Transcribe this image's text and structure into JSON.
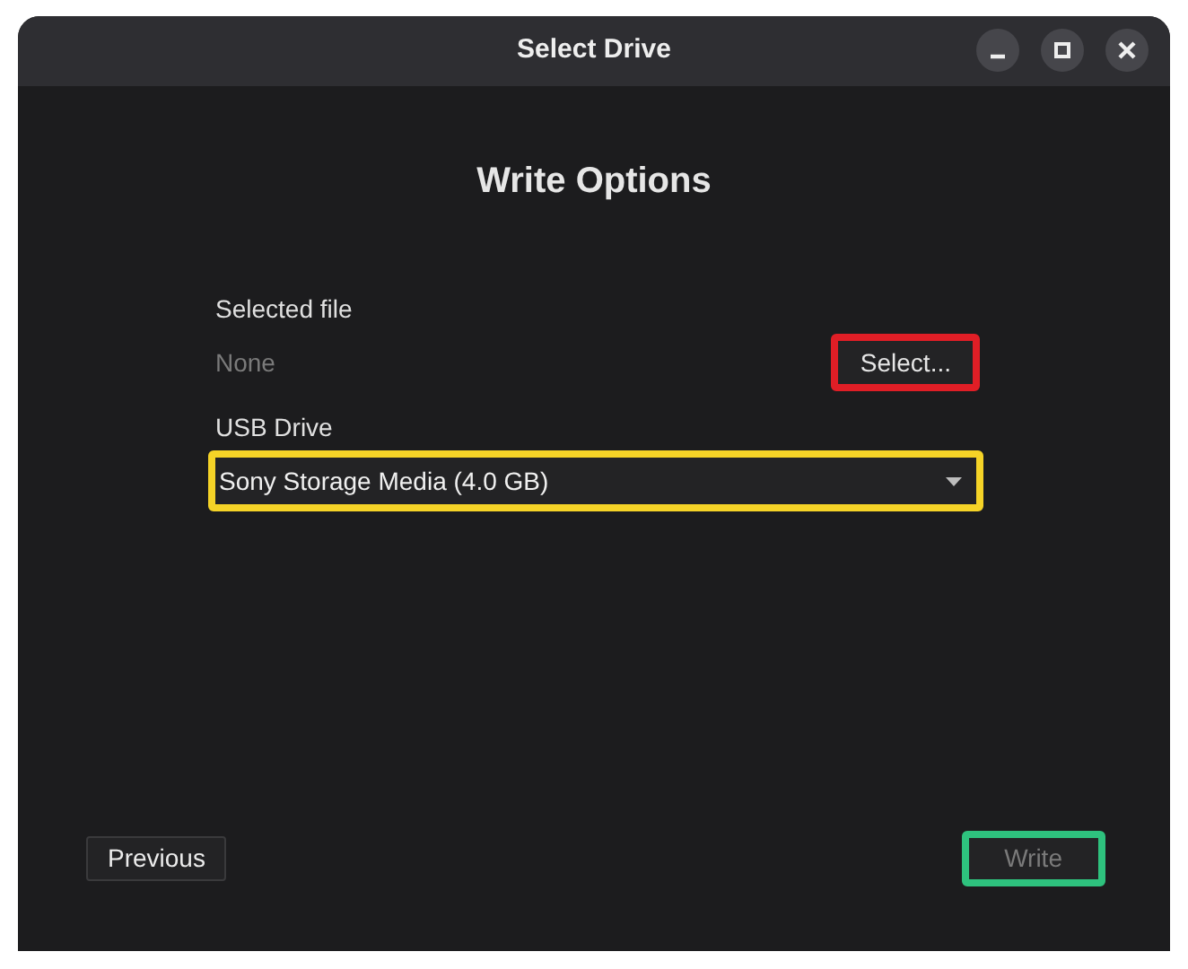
{
  "window": {
    "title": "Select Drive",
    "controls": [
      {
        "kind": "minimize"
      },
      {
        "kind": "maximize"
      },
      {
        "kind": "close"
      }
    ]
  },
  "heading": "Write Options",
  "selected_file": {
    "label": "Selected file",
    "value": "None",
    "button": {
      "label": "Select...",
      "disabled": false
    }
  },
  "usb_drive": {
    "label": "USB Drive",
    "value": "Sony Storage Media (4.0 GB)"
  },
  "buttons": [
    {
      "label": "Previous",
      "disabled": false
    },
    {
      "label": "Write",
      "disabled": true
    }
  ],
  "highlights": [
    {
      "color": "#e01e26"
    },
    {
      "color": "#f5d327"
    },
    {
      "color": "#2ec27e"
    }
  ]
}
